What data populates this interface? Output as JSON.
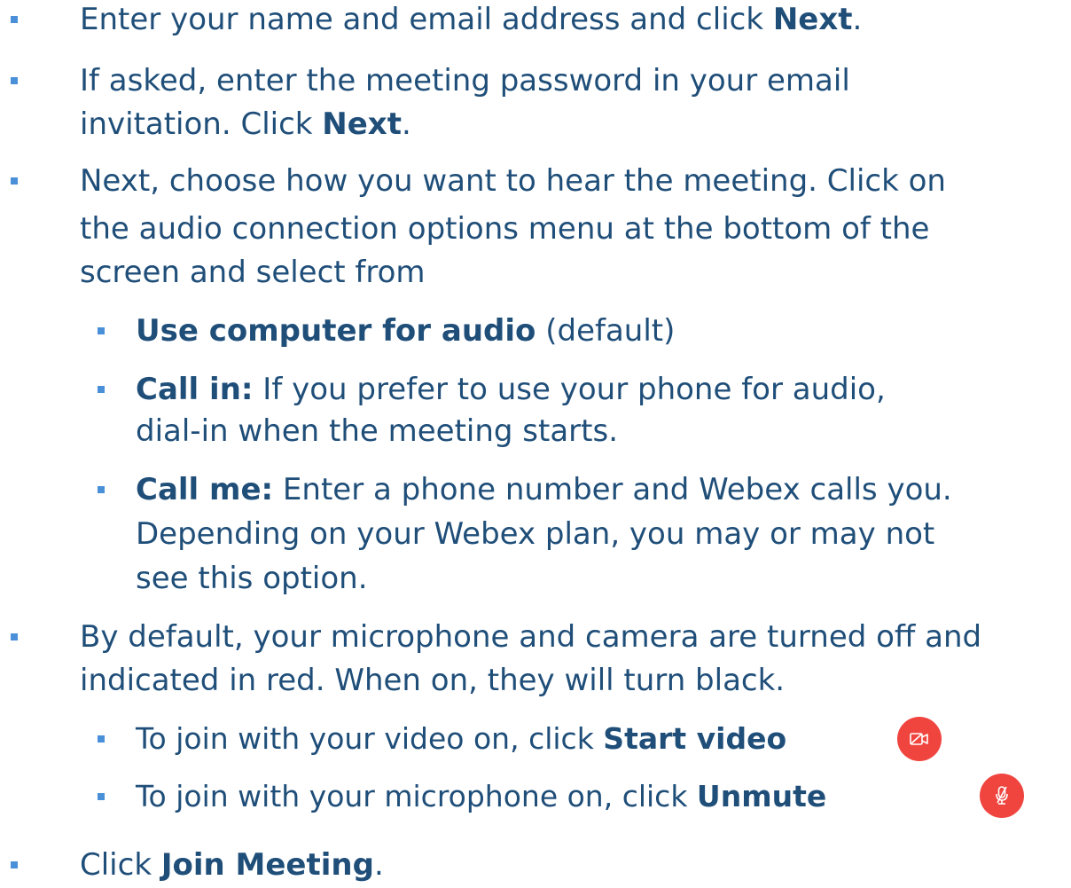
{
  "steps": [
    {
      "pre": "Enter your name and email address and click ",
      "bold": "Next",
      "post": "."
    },
    {
      "line1": "If asked, enter the meeting password in your email",
      "line2_pre": "invitation. Click ",
      "line2_bold": "Next",
      "line2_post": "."
    },
    {
      "line1": "Next, choose how you want to hear the meeting. Click on",
      "line2": "the audio connection options menu at the bottom of the",
      "line3": "screen and select from",
      "options": [
        {
          "bold": "Use computer for audio",
          "text": "(default)"
        },
        {
          "bold": "Call in:",
          "line1": " If you prefer to use your phone for audio,",
          "line2": "dial-in when the meeting starts."
        },
        {
          "bold": "Call me:",
          "line1": " Enter a phone number and Webex calls you.",
          "line2": "Depending on your Webex plan, you may or may not",
          "line3": "see this option."
        }
      ]
    },
    {
      "line1": "By default, your microphone and camera are turned off and",
      "line2": "indicated in red. When on, they will turn black.",
      "subs": [
        {
          "pre": "To join with your video on, click ",
          "bold": "Start video",
          "icon": "video-off-icon"
        },
        {
          "pre": "To join with your microphone on, click ",
          "bold": "Unmute",
          "icon": "mic-muted-icon"
        }
      ]
    },
    {
      "pre": "Click ",
      "bold": "Join Meeting",
      "post": "."
    }
  ],
  "colors": {
    "text": "#1f4e79",
    "bullet": "#4a90d9",
    "icon_bg": "#f0443f"
  }
}
